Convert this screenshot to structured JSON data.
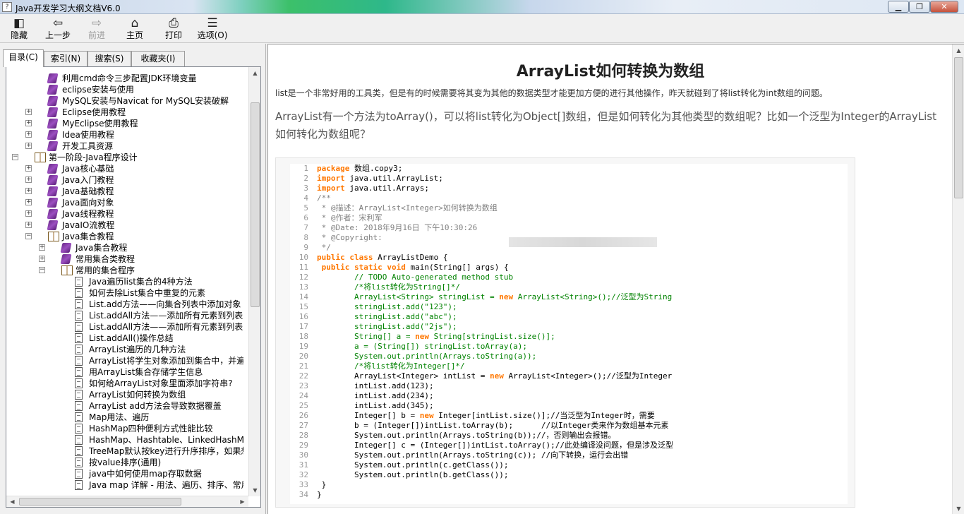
{
  "window": {
    "title": "Java开发学习大纲文档V6.0",
    "icon_name": "help-doc-icon",
    "buttons": {
      "minimize": "▁",
      "maximize": "❐",
      "close": "✕"
    }
  },
  "toolbar": {
    "hide": "隐藏",
    "back": "上一步",
    "forward": "前进",
    "home": "主页",
    "print": "打印",
    "options": "选项(O)"
  },
  "tabs": [
    {
      "label": "目录(C)",
      "active": true
    },
    {
      "label": "索引(N)",
      "active": false
    },
    {
      "label": "搜索(S)",
      "active": false
    },
    {
      "label": "收藏夹(I)",
      "active": false
    }
  ],
  "tree": [
    {
      "label": "利用cmd命令三步配置JDK环境变量",
      "level": 1,
      "icon": "book",
      "exp": ""
    },
    {
      "label": "eclipse安装与使用",
      "level": 1,
      "icon": "book",
      "exp": ""
    },
    {
      "label": "MySQL安装与Navicat for MySQL安装破解",
      "level": 1,
      "icon": "book",
      "exp": ""
    },
    {
      "label": "Eclipse使用教程",
      "level": 1,
      "icon": "book",
      "exp": "+"
    },
    {
      "label": "MyEclipse使用教程",
      "level": 1,
      "icon": "book",
      "exp": "+"
    },
    {
      "label": "Idea使用教程",
      "level": 1,
      "icon": "book",
      "exp": "+"
    },
    {
      "label": "开发工具资源",
      "level": 1,
      "icon": "book",
      "exp": "+"
    },
    {
      "label": "第一阶段-Java程序设计",
      "level": 0,
      "icon": "openbook",
      "exp": "−"
    },
    {
      "label": "Java核心基础",
      "level": 1,
      "icon": "book",
      "exp": "+"
    },
    {
      "label": "Java入门教程",
      "level": 1,
      "icon": "book",
      "exp": "+"
    },
    {
      "label": "Java基础教程",
      "level": 1,
      "icon": "book",
      "exp": "+"
    },
    {
      "label": "Java面向对象",
      "level": 1,
      "icon": "book",
      "exp": "+"
    },
    {
      "label": "Java线程教程",
      "level": 1,
      "icon": "book",
      "exp": "+"
    },
    {
      "label": "JavaIO流教程",
      "level": 1,
      "icon": "book",
      "exp": "+"
    },
    {
      "label": "Java集合教程",
      "level": 1,
      "icon": "openbook",
      "exp": "−"
    },
    {
      "label": "Java集合教程",
      "level": 2,
      "icon": "book",
      "exp": "+"
    },
    {
      "label": "常用集合类教程",
      "level": 2,
      "icon": "book",
      "exp": "+"
    },
    {
      "label": "常用的集合程序",
      "level": 2,
      "icon": "openbook",
      "exp": "−"
    },
    {
      "label": "Java遍历list集合的4种方法",
      "level": 3,
      "icon": "page",
      "exp": ""
    },
    {
      "label": "如何去除List集合中重复的元素",
      "level": 3,
      "icon": "page",
      "exp": ""
    },
    {
      "label": "List.add方法——向集合列表中添加对象",
      "level": 3,
      "icon": "page",
      "exp": ""
    },
    {
      "label": "List.addAll方法——添加所有元素到列表中",
      "level": 3,
      "icon": "page",
      "exp": ""
    },
    {
      "label": "List.addAll方法——添加所有元素到列表中",
      "level": 3,
      "icon": "page",
      "exp": ""
    },
    {
      "label": "List.addAll()操作总结",
      "level": 3,
      "icon": "page",
      "exp": ""
    },
    {
      "label": "ArrayList遍历的几种方法",
      "level": 3,
      "icon": "page",
      "exp": ""
    },
    {
      "label": "ArrayList将学生对象添加到集合中，并遍历",
      "level": 3,
      "icon": "page",
      "exp": ""
    },
    {
      "label": "用ArrayList集合存储学生信息",
      "level": 3,
      "icon": "page",
      "exp": ""
    },
    {
      "label": "如何给ArrayList对象里面添加字符串?",
      "level": 3,
      "icon": "page",
      "exp": ""
    },
    {
      "label": "ArrayList如何转换为数组",
      "level": 3,
      "icon": "page",
      "exp": ""
    },
    {
      "label": "ArrayList add方法会导致数据覆盖",
      "level": 3,
      "icon": "page",
      "exp": ""
    },
    {
      "label": "Map用法、遍历",
      "level": 3,
      "icon": "page",
      "exp": ""
    },
    {
      "label": "HashMap四种便利方式性能比较",
      "level": 3,
      "icon": "page",
      "exp": ""
    },
    {
      "label": "HashMap、Hashtable、LinkedHashMap排序",
      "level": 3,
      "icon": "page",
      "exp": ""
    },
    {
      "label": "TreeMap默认按key进行升序排序，如果想改变",
      "level": 3,
      "icon": "page",
      "exp": ""
    },
    {
      "label": "按value排序(通用)",
      "level": 3,
      "icon": "page",
      "exp": ""
    },
    {
      "label": "java中如何使用map存取数据",
      "level": 3,
      "icon": "page",
      "exp": ""
    },
    {
      "label": "Java map 详解 - 用法、遍历、排序、常用A",
      "level": 3,
      "icon": "page",
      "exp": ""
    }
  ],
  "doc": {
    "title": "ArrayList如何转换为数组",
    "intro": "list是一个非常好用的工具类，但是有的时候需要将其变为其他的数据类型才能更加方便的进行其他操作，昨天就碰到了将list转化为int数组的问题。",
    "question": "ArrayList有一个方法为toArray()，可以将list转化为Object[]数组，但是如何转化为其他类型的数组呢？比如一个泛型为Integer的ArrayList如何转化为数组呢？"
  },
  "code": [
    {
      "n": "1",
      "t": "package 数组.copy3;",
      "c": "#000000",
      "kw": false
    },
    {
      "n": "2",
      "t": "import java.util.ArrayList;",
      "c": "#000000",
      "kw": false
    },
    {
      "n": "3",
      "t": "import java.util.Arrays;",
      "c": "#000000",
      "kw": false
    },
    {
      "n": "4",
      "t": "/**",
      "c": "#808080",
      "kw": false
    },
    {
      "n": "5",
      "t": " * @描述：ArrayList<Integer>如何转换为数组",
      "c": "#808080",
      "kw": false
    },
    {
      "n": "6",
      "t": " * @作者：宋利军",
      "c": "#808080",
      "kw": false
    },
    {
      "n": "7",
      "t": " * @Date: 2018年9月16日 下午10:30:26",
      "c": "#808080",
      "kw": false
    },
    {
      "n": "8",
      "t": " * @Copyright:",
      "c": "#808080",
      "kw": false
    },
    {
      "n": "9",
      "t": " */",
      "c": "#808080",
      "kw": false
    },
    {
      "n": "10",
      "t": "public class ArrayListDemo {",
      "c": "#000000",
      "kw": false
    },
    {
      "n": "11",
      "t": " public static void main(String[] args) {",
      "c": "#000000",
      "kw": false
    },
    {
      "n": "12",
      "t": "        // TODO Auto-generated method stub",
      "c": "#008200",
      "kw": false
    },
    {
      "n": "13",
      "t": "        /*将list转化为String[]*/",
      "c": "#008200",
      "kw": false
    },
    {
      "n": "14",
      "t": "        ArrayList<String> stringList = new ArrayList<String>();//泛型为String",
      "c": "#008200",
      "kw": false
    },
    {
      "n": "15",
      "t": "        stringList.add(\"123\");",
      "c": "#008200",
      "kw": false
    },
    {
      "n": "16",
      "t": "        stringList.add(\"abc\");",
      "c": "#008200",
      "kw": false
    },
    {
      "n": "17",
      "t": "        stringList.add(\"2js\");",
      "c": "#008200",
      "kw": false
    },
    {
      "n": "18",
      "t": "        String[] a = new String[stringList.size()];",
      "c": "#008200",
      "kw": false
    },
    {
      "n": "19",
      "t": "        a = (String[]) stringList.toArray(a);",
      "c": "#008200",
      "kw": false
    },
    {
      "n": "20",
      "t": "        System.out.println(Arrays.toString(a));",
      "c": "#008200",
      "kw": false
    },
    {
      "n": "21",
      "t": "        /*将list转化为Integer[]*/",
      "c": "#008200",
      "kw": false
    },
    {
      "n": "22",
      "t": "        ArrayList<Integer> intList = new ArrayList<Integer>();//泛型为Integer",
      "c": "#000000",
      "kw": false
    },
    {
      "n": "23",
      "t": "        intList.add(123);",
      "c": "#000000",
      "kw": false
    },
    {
      "n": "24",
      "t": "        intList.add(234);",
      "c": "#000000",
      "kw": false
    },
    {
      "n": "25",
      "t": "        intList.add(345);",
      "c": "#000000",
      "kw": false
    },
    {
      "n": "26",
      "t": "        Integer[] b = new Integer[intList.size()];//当泛型为Integer时，需要",
      "c": "#000000",
      "kw": false
    },
    {
      "n": "27",
      "t": "        b = (Integer[])intList.toArray(b);      //以Integer类来作为数组基本元素",
      "c": "#000000",
      "kw": false
    },
    {
      "n": "28",
      "t": "        System.out.println(Arrays.toString(b));//，否则输出会报错。",
      "c": "#000000",
      "kw": false
    },
    {
      "n": "29",
      "t": "        Integer[] c = (Integer[])intList.toArray();//此处编译没问题，但是涉及泛型",
      "c": "#000000",
      "kw": false
    },
    {
      "n": "30",
      "t": "        System.out.println(Arrays.toString(c)); //向下转换，运行会出错",
      "c": "#000000",
      "kw": false
    },
    {
      "n": "31",
      "t": "        System.out.println(c.getClass());",
      "c": "#000000",
      "kw": false
    },
    {
      "n": "32",
      "t": "        System.out.println(b.getClass());",
      "c": "#000000",
      "kw": false
    },
    {
      "n": "33",
      "t": " }",
      "c": "#000000",
      "kw": false
    },
    {
      "n": "34",
      "t": "}",
      "c": "#000000",
      "kw": false
    }
  ],
  "colors": {
    "keyword": "#ff7700",
    "comment": "#008200",
    "doc_comment": "#808080",
    "line_number": "#999999"
  }
}
